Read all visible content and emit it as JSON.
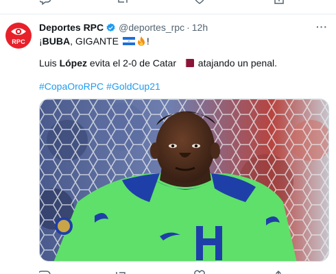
{
  "tweet": {
    "display_name": "Deportes RPC",
    "handle": "@deportes_rpc",
    "separator": "·",
    "time": "12h",
    "avatar_label": "RPC",
    "more_label": "···",
    "line1": {
      "prefix": "¡",
      "bold": "BUBA",
      "middle": ", GIGANTE ",
      "suffix": "!"
    },
    "line2": {
      "prefix": "Luis ",
      "bold": "López",
      "middle": " evita el 2-0 de Catar ",
      "suffix": " atajando un penal."
    },
    "hashtags": [
      "#CopaOroRPC",
      "#GoldCup21"
    ]
  },
  "icons": {
    "verified": "verified-badge-icon",
    "honduras_flag": "honduras-flag-emoji",
    "fire": "fire-emoji",
    "qatar_flag": "qatar-flag-emoji",
    "reply": "reply-icon",
    "retweet": "retweet-icon",
    "like": "like-icon",
    "share": "share-icon"
  },
  "colors": {
    "link": "#1d9bf0",
    "text": "#0f1419",
    "muted": "#536471",
    "brand_red": "#e8202a",
    "jersey_green": "#5ee06a",
    "jersey_blue": "#1f3fa8"
  }
}
